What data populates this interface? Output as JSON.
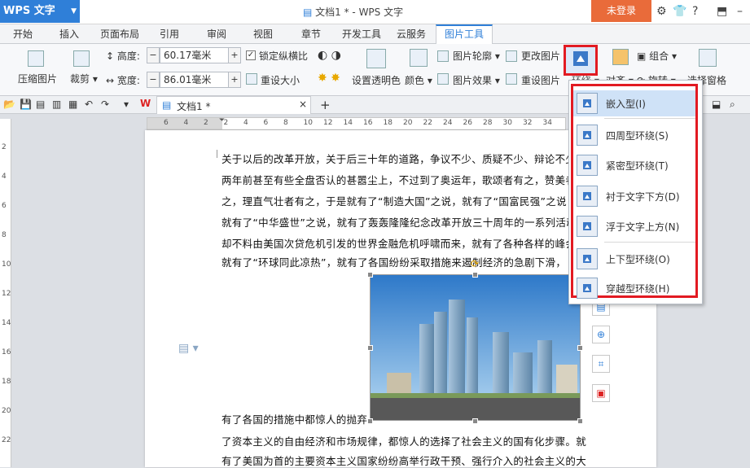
{
  "titlebar": {
    "app_name": "WPS 文字",
    "doc_title": "文档1 * - WPS 文字",
    "login": "未登录"
  },
  "menu": {
    "tabs": [
      "开始",
      "插入",
      "页面布局",
      "引用",
      "审阅",
      "视图",
      "章节",
      "开发工具",
      "云服务",
      "图片工具"
    ],
    "active": "图片工具"
  },
  "ribbon": {
    "compress": "压缩图片",
    "crop": "裁剪",
    "height_label": "高度:",
    "height_value": "60.17毫米",
    "width_label": "宽度:",
    "width_value": "86.01毫米",
    "lock_ratio": "锁定纵横比",
    "reset_size": "重设大小",
    "transparent": "设置透明色",
    "color": "颜色",
    "outline": "图片轮廓",
    "effect": "图片效果",
    "change_pic": "更改图片",
    "reset_pic": "重设图片",
    "wrap": "环绕",
    "align": "对齐",
    "group": "组合",
    "rotate": "旋转",
    "select_pane": "选择窗格"
  },
  "doctab": {
    "label": "文档1 *"
  },
  "ruler": {
    "ticks": [
      "6",
      "4",
      "2",
      "2",
      "4",
      "6",
      "8",
      "10",
      "12",
      "14",
      "16",
      "18",
      "20",
      "22",
      "24",
      "26",
      "28",
      "30",
      "32",
      "34"
    ]
  },
  "ruler_v": {
    "ticks": [
      "2",
      "4",
      "6",
      "8",
      "10",
      "12",
      "14",
      "16",
      "18",
      "20",
      "22"
    ]
  },
  "document": {
    "lines": [
      "关于以后的改革开放，关于后三十年的道路，争议不少、质疑不少、辩论不少",
      "两年前甚至有些全盘否认的甚嚣尘上，不过到了奥运年，歌颂者有之，赞美者",
      "之，理直气壮者有之，于是就有了“制造大国”之说，就有了“国富民强”之说",
      "就有了“中华盛世”之说，就有了轰轰隆隆纪念改革开放三十周年的一系列活动",
      "却不料由美国次贷危机引发的世界金融危机呼啸而来，就有了各种各样的峰会",
      "就有了“环球同此凉热”，就有了各国纷纷采取措施来遏制经济的急剧下滑，"
    ],
    "lines_bottom": [
      "有了各国的措施中都惊人的抛弃",
      "了资本主义的自由经济和市场规律，都惊人的选择了社会主义的国有化步骤。就",
      "有了美国为首的主要资本主义国家纷纷高举行政干预、强行介入的社会主义的大"
    ]
  },
  "dropdown": {
    "items": [
      {
        "label": "嵌入型(I)",
        "selected": true
      },
      {
        "label": "四周型环绕(S)",
        "selected": false
      },
      {
        "label": "紧密型环绕(T)",
        "selected": false
      },
      {
        "label": "衬于文字下方(D)",
        "selected": false
      },
      {
        "label": "浮于文字上方(N)",
        "selected": false
      },
      {
        "label": "上下型环绕(O)",
        "selected": false
      },
      {
        "label": "穿越型环绕(H)",
        "selected": false
      }
    ]
  },
  "colors": {
    "accent": "#2f7fd8",
    "highlight": "#e21a22",
    "login": "#e96b3a"
  }
}
